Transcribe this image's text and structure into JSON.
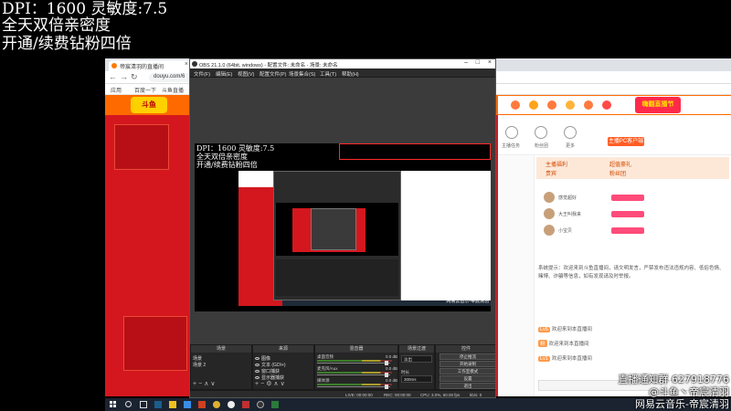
{
  "overlay": {
    "line1": "DPI：1600 灵敏度:7.5",
    "line2": "全天双倍亲密度",
    "line3": "开通/续费钻粉四倍"
  },
  "watermark": {
    "line1": "直播通知群 627918776",
    "line2": "@斗鱼丶帝宸清羽",
    "line3": "网易云音乐-帝宸清羽"
  },
  "browser": {
    "tab_title": "帝宸清羽的直播间",
    "url": "douyu.com/6",
    "bookmarks": [
      "应用",
      "百度一下",
      "斗鱼直播"
    ],
    "header_badge": "嗨翻直播节",
    "header_logo": "斗鱼"
  },
  "chat": {
    "top_items": [
      "主播任务",
      "粉丝团",
      "更多"
    ],
    "pc_button": "主播PC客户端",
    "rank_tabs": [
      "主播福利",
      "超值豪礼",
      "贵宾",
      "粉丝团"
    ],
    "rank_rows": [
      "感觉超好",
      "大王叫我来",
      "小宝贝"
    ],
    "notice": "系统提示：欢迎来到斗鱼直播间，请文明发言，严禁发布违法违规内容、低俗色情、赌博、诈骗等信息，如有发现请及时举报。",
    "lines": [
      {
        "tag": "Lv5",
        "text": "欢迎来到本直播间"
      },
      {
        "tag": "粉",
        "text": "欢迎来到本直播间"
      },
      {
        "tag": "Lv1",
        "text": "欢迎来到本直播间"
      }
    ]
  },
  "obs": {
    "title": "OBS 21.1.0 (64bit, windows) - 配置文件: 未命名 - 场景: 未命名",
    "menu": [
      "文件(F)",
      "编辑(E)",
      "视图(V)",
      "配置文件(P)",
      "场景集合(S)",
      "工具(T)",
      "帮助(H)"
    ],
    "preview_overlay": [
      "DPI：1600 灵敏度:7.5",
      "全天双倍亲密度",
      "开通/续费钻粉四倍"
    ],
    "preview_watermark": [
      "直播通知群 627918776",
      "@斗鱼丶帝宸清羽",
      "网易云音乐-帝宸清羽"
    ],
    "docks": {
      "scenes": {
        "title": "场景",
        "items": [
          "场景",
          "场景 2"
        ]
      },
      "sources": {
        "title": "来源",
        "items": [
          "图像",
          "文本 (GDI+)",
          "窗口捕获",
          "显示器捕获"
        ]
      },
      "mixer": {
        "title": "混音器",
        "rows": [
          {
            "name": "桌面音频",
            "db": "0.0 dB"
          },
          {
            "name": "麦克风/Aux",
            "db": "0.0 dB"
          },
          {
            "name": "媒体源",
            "db": "0.0 dB"
          }
        ]
      },
      "transitions": {
        "title": "场景过渡",
        "type": "淡出",
        "duration_label": "时长",
        "duration": "300ms"
      },
      "controls": {
        "title": "控件",
        "buttons": [
          "停止推流",
          "开始录制",
          "工作室模式",
          "设置",
          "退出"
        ]
      }
    },
    "status": {
      "live": "LIVE: 00:00:00",
      "rec": "REC: 00:00:00",
      "cpu": "CPU: 3.0%, 60.00 fps",
      "kbps": "kb/s: 0"
    }
  },
  "colors": {
    "accent": "#ff6a00",
    "page_red": "#d4171e",
    "obs_bg": "#2b2b2b",
    "taskbar": "#1b2331"
  }
}
